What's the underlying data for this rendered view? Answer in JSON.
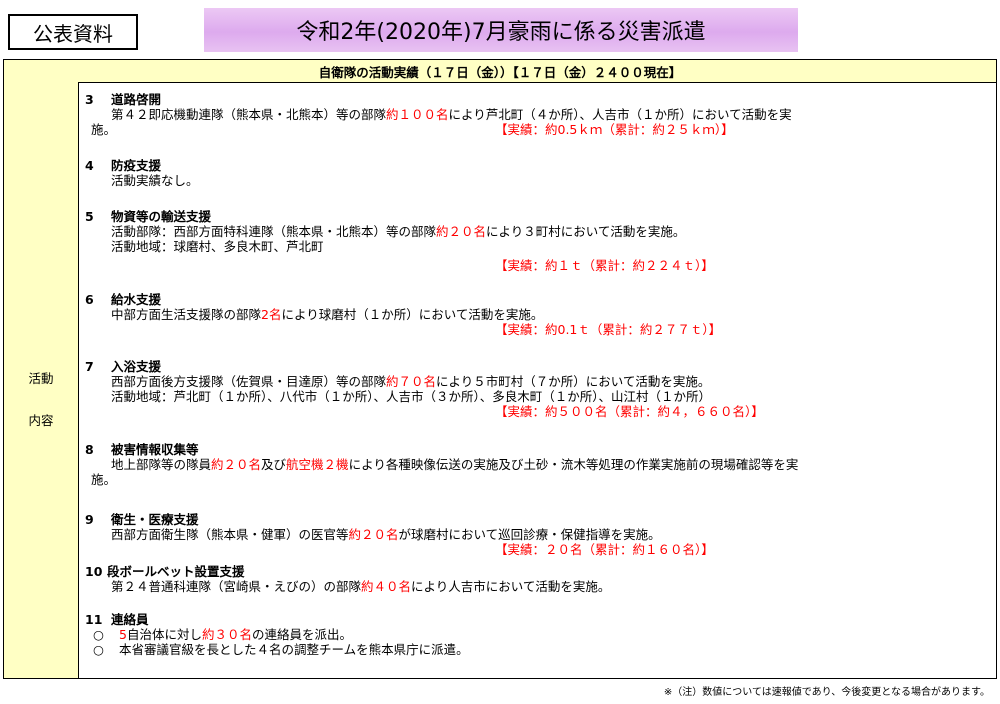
{
  "badge": "公表資料",
  "title": "令和2年(2020年)7月豪雨に係る災害派遣",
  "table_header": "自衛隊の活動実績（１７日（金））【１７日（金）２４００現在】",
  "left_label_1": "活動",
  "left_label_2": "内容",
  "sections": {
    "s3": {
      "num": "3",
      "title": "道路啓開",
      "line1_a": "第４２即応機動連隊（熊本県・北熊本）等の部隊",
      "line1_red": "約１００名",
      "line1_b": "により芦北町（４か所）、人吉市（１か所）において活動を実",
      "line2": "施。",
      "result": "【実績：約0.5ｋｍ（累計：約２５ｋｍ）】"
    },
    "s4": {
      "num": "4",
      "title": "防疫支援",
      "line1": "活動実績なし。"
    },
    "s5": {
      "num": "5",
      "title": "物資等の輸送支援",
      "line1_a": "活動部隊：西部方面特科連隊（熊本県・北熊本）等の部隊",
      "line1_red": "約２０名",
      "line1_b": "により３町村において活動を実施。",
      "line2": "活動地域：球磨村、多良木町、芦北町",
      "result": "【実績：約１ｔ（累計：約２２４ｔ）】"
    },
    "s6": {
      "num": "6",
      "title": "給水支援",
      "line1_a": "中部方面生活支援隊の部隊",
      "line1_red": "2名",
      "line1_b": "により球磨村（１か所）において活動を実施。",
      "result": "【実績：約0.1ｔ（累計：約２７７ｔ）】"
    },
    "s7": {
      "num": "7",
      "title": "入浴支援",
      "line1_a": "西部方面後方支援隊（佐賀県・目達原）等の部隊",
      "line1_red": "約７０名",
      "line1_b": "により５市町村（７か所）において活動を実施。",
      "line2": "活動地域：芦北町（１か所）、八代市（１か所）、人吉市（３か所）、多良木町（１か所）、山江村（１か所）",
      "result": "【実績：約５００名（累計：約４，６６０名）】"
    },
    "s8": {
      "num": "8",
      "title": "被害情報収集等",
      "line1_a": "地上部隊等の隊員",
      "line1_red": "約２０名",
      "line1_b": "及び",
      "line1_red2": "航空機２機",
      "line1_c": "により各種映像伝送の実施及び土砂・流木等処理の作業実施前の現場確認等を実",
      "line2": "施。"
    },
    "s9": {
      "num": "9",
      "title": "衛生・医療支援",
      "line1_a": "西部方面衛生隊（熊本県・健軍）の医官等",
      "line1_red": "約２０名",
      "line1_b": "が球磨村において巡回診療・保健指導を実施。",
      "result": "【実績：２０名（累計：約１６０名）】"
    },
    "s10": {
      "num": "10",
      "title": "段ボールベット設置支援",
      "line1_a": "第２４普通科連隊（宮崎県・えびの）の部隊",
      "line1_red": "約４０名",
      "line1_b": "により人吉市において活動を実施。"
    },
    "s11": {
      "num": "11",
      "title": "連絡員",
      "bullet": "○",
      "b1_red": "5",
      "b1_a": "自治体に対し",
      "b1_red2": "約３０名",
      "b1_b": "の連絡員を派出。",
      "b2": "本省審議官級を長とした４名の調整チームを熊本県庁に派遣。"
    }
  },
  "footnote": "※（注）数値については速報値であり、今後変更となる場合があります。"
}
